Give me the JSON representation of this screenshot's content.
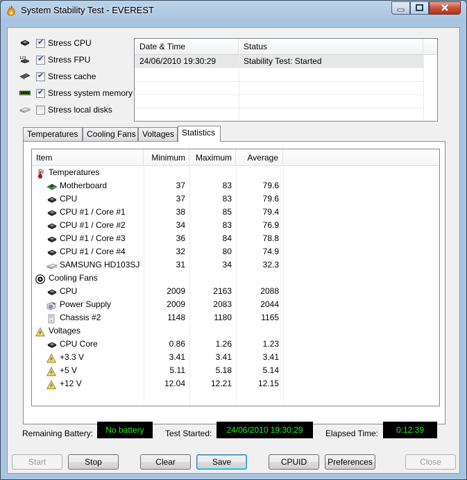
{
  "window": {
    "title": "System Stability Test - EVEREST"
  },
  "stress_options": [
    {
      "label": "Stress CPU",
      "checked": true,
      "icon": "cpu-chip-icon"
    },
    {
      "label": "Stress FPU",
      "checked": true,
      "icon": "fpu-icon"
    },
    {
      "label": "Stress cache",
      "checked": true,
      "icon": "cache-chip-icon"
    },
    {
      "label": "Stress system memory",
      "checked": true,
      "icon": "memory-module-icon"
    },
    {
      "label": "Stress local disks",
      "checked": false,
      "icon": "hard-disk-icon"
    }
  ],
  "log": {
    "columns": [
      "Date & Time",
      "Status"
    ],
    "rows": [
      {
        "datetime": "24/06/2010 19:30:29",
        "status": "Stability Test: Started"
      }
    ]
  },
  "tabs": [
    {
      "label": "Temperatures",
      "active": false
    },
    {
      "label": "Cooling Fans",
      "active": false
    },
    {
      "label": "Voltages",
      "active": false
    },
    {
      "label": "Statistics",
      "active": true
    }
  ],
  "stats": {
    "columns": [
      "Item",
      "Minimum",
      "Maximum",
      "Average"
    ],
    "rows": [
      {
        "group": true,
        "icon": "thermometer-icon",
        "name": "Temperatures"
      },
      {
        "icon": "motherboard-icon",
        "name": "Motherboard",
        "min": "37",
        "max": "83",
        "avg": "79.6"
      },
      {
        "icon": "cpu-chip-icon",
        "name": "CPU",
        "min": "37",
        "max": "83",
        "avg": "79.6"
      },
      {
        "icon": "cpu-chip-icon",
        "name": "CPU #1 / Core #1",
        "min": "38",
        "max": "85",
        "avg": "79.4"
      },
      {
        "icon": "cpu-chip-icon",
        "name": "CPU #1 / Core #2",
        "min": "34",
        "max": "83",
        "avg": "76.9"
      },
      {
        "icon": "cpu-chip-icon",
        "name": "CPU #1 / Core #3",
        "min": "36",
        "max": "84",
        "avg": "78.8"
      },
      {
        "icon": "cpu-chip-icon",
        "name": "CPU #1 / Core #4",
        "min": "32",
        "max": "80",
        "avg": "74.9"
      },
      {
        "icon": "hard-disk-icon",
        "name": "SAMSUNG HD103SJ",
        "min": "31",
        "max": "34",
        "avg": "32.3"
      },
      {
        "group": true,
        "icon": "fan-icon",
        "name": "Cooling Fans"
      },
      {
        "icon": "cpu-chip-icon",
        "name": "CPU",
        "min": "2009",
        "max": "2163",
        "avg": "2088"
      },
      {
        "icon": "power-supply-icon",
        "name": "Power Supply",
        "min": "2009",
        "max": "2083",
        "avg": "2044"
      },
      {
        "icon": "chassis-icon",
        "name": "Chassis #2",
        "min": "1148",
        "max": "1180",
        "avg": "1165"
      },
      {
        "group": true,
        "icon": "voltage-icon",
        "name": "Voltages"
      },
      {
        "icon": "cpu-chip-icon",
        "name": "CPU Core",
        "min": "0.86",
        "max": "1.26",
        "avg": "1.23"
      },
      {
        "icon": "voltage-icon",
        "name": "+3.3 V",
        "min": "3.41",
        "max": "3.41",
        "avg": "3.41"
      },
      {
        "icon": "voltage-icon",
        "name": "+5 V",
        "min": "5.11",
        "max": "5.18",
        "avg": "5.14"
      },
      {
        "icon": "voltage-icon",
        "name": "+12 V",
        "min": "12.04",
        "max": "12.21",
        "avg": "12.15"
      }
    ]
  },
  "status_bar": {
    "battery_label": "Remaining Battery:",
    "battery_value": "No battery",
    "started_label": "Test Started:",
    "started_value": "24/06/2010 19:30:29",
    "elapsed_label": "Elapsed Time:",
    "elapsed_value": "0:12:39"
  },
  "buttons": {
    "start": "Start",
    "stop": "Stop",
    "clear": "Clear",
    "save": "Save",
    "cpuid": "CPUID",
    "preferences": "Preferences",
    "close": "Close"
  },
  "colors": {
    "lcd_text": "#1ef01e",
    "lcd_bg": "#000000",
    "close_button": "#c7513a"
  }
}
